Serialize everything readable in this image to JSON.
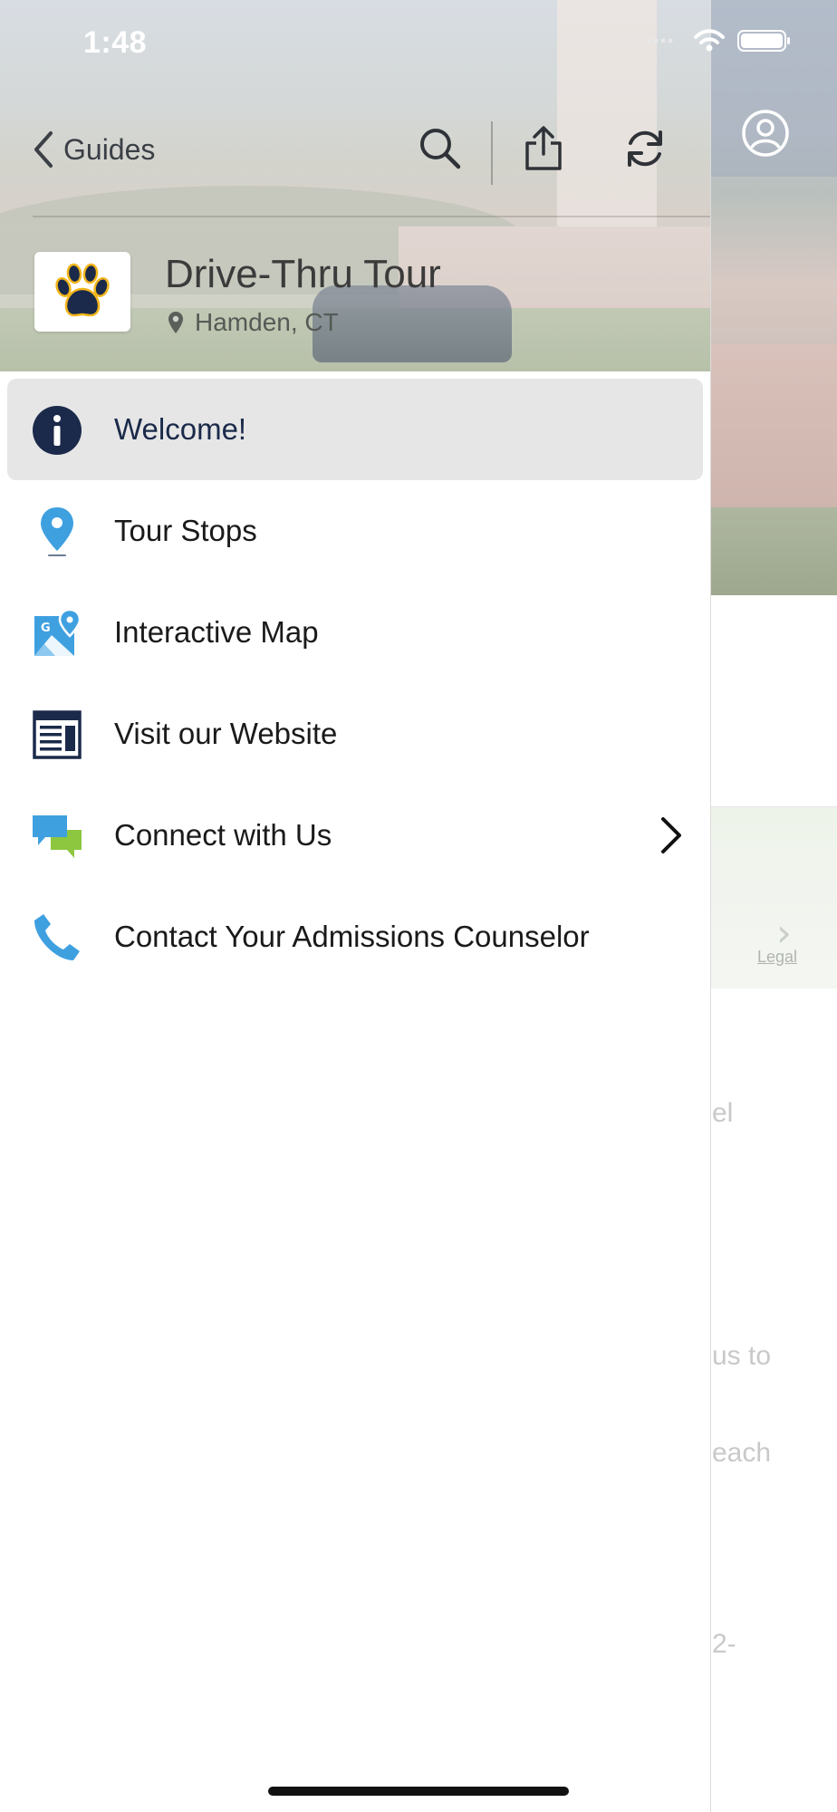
{
  "status_bar": {
    "time": "1:48"
  },
  "toolbar": {
    "back_label": "Guides"
  },
  "guide": {
    "title": "Drive-Thru Tour",
    "location": "Hamden, CT"
  },
  "menu": {
    "items": [
      {
        "label": "Welcome!",
        "icon": "info-icon",
        "selected": true
      },
      {
        "label": "Tour Stops",
        "icon": "map-pin-icon"
      },
      {
        "label": "Interactive Map",
        "icon": "map-icon"
      },
      {
        "label": "Visit our Website",
        "icon": "website-icon"
      },
      {
        "label": "Connect with Us",
        "icon": "chat-bubbles-icon",
        "has_submenu": true
      },
      {
        "label": "Contact Your Admissions Counselor",
        "icon": "phone-icon"
      }
    ]
  },
  "background": {
    "map_legal": "Legal",
    "text_fragments": [
      "el",
      "us to",
      "each",
      "2-"
    ]
  },
  "colors": {
    "navy": "#1b2a4a",
    "gold": "#f2b61c",
    "accent_blue": "#3fa0e0",
    "accent_green": "#8dc63f",
    "selected_bg": "#e6e6e6"
  }
}
